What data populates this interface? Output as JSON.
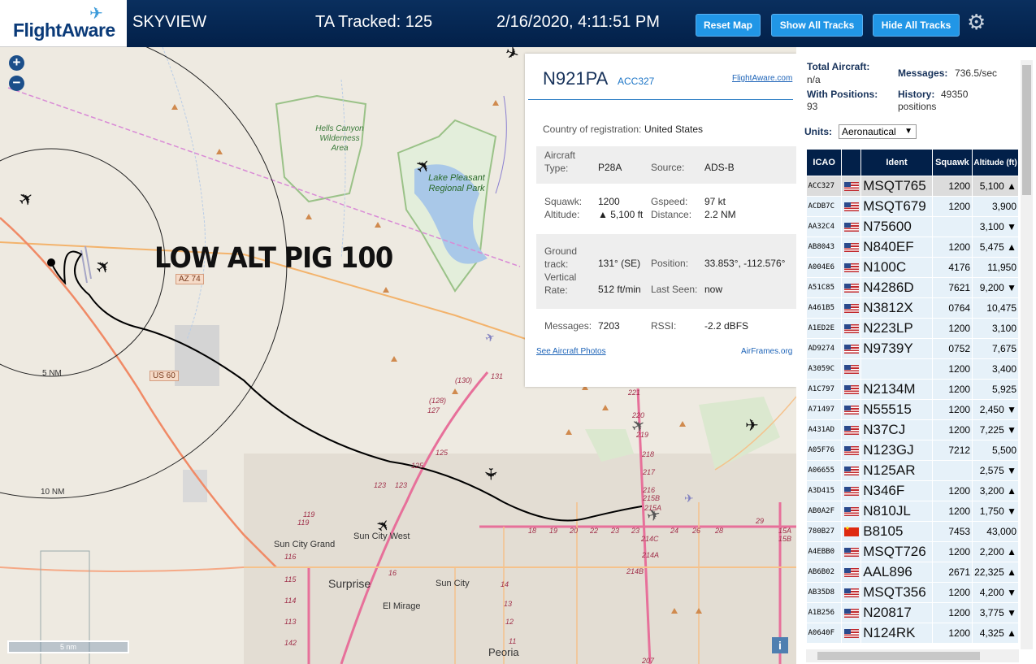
{
  "header": {
    "logo_text": "FlightAware",
    "app_name": "SKYVIEW",
    "tracked": "TA Tracked: 125",
    "datetime": "2/16/2020, 4:11:51 PM",
    "buttons": {
      "reset_map": "Reset Map",
      "show_all_tracks": "Show All Tracks",
      "hide_all_tracks": "Hide All Tracks"
    },
    "settings_icon": "gear-icon"
  },
  "map": {
    "zoom_in": "+",
    "zoom_out": "−",
    "overlay_text": "LOW ALT PIG 100",
    "range_labels": {
      "r5": "5 NM",
      "r10": "10 NM"
    },
    "places": {
      "hells_canyon": "Hells Canyon Wilderness Area",
      "lake_pleasant": "Lake Pleasant Regional Park",
      "sun_city_grand": "Sun City Grand",
      "sun_city_west": "Sun City West",
      "surprise": "Surprise",
      "sun_city": "Sun City",
      "el_mirage": "El Mirage",
      "peoria": "Peoria"
    },
    "shields": {
      "az74": "AZ 74",
      "us60": "US 60"
    },
    "scale": "5 nm",
    "info_button": "i",
    "exit_numbers": [
      "131",
      "(130)",
      "(128)",
      "127",
      "125",
      "125",
      "123",
      "123",
      "119",
      "119",
      "116",
      "115",
      "114",
      "113",
      "142",
      "16",
      "18",
      "19",
      "20",
      "22",
      "23",
      "23",
      "24",
      "26",
      "28",
      "29",
      "221",
      "220",
      "219",
      "218",
      "217",
      "216",
      "215B",
      "215A",
      "214C",
      "214A",
      "214B",
      "207",
      "15A",
      "15B",
      "14",
      "13",
      "12",
      "11"
    ]
  },
  "popup": {
    "registration": "N921PA",
    "callsign": "ACC327",
    "fa_link": "FlightAware.com",
    "country_label": "Country of registration:",
    "country_value": "United States",
    "aircraft_type_label": "Aircraft\nType:",
    "aircraft_type_value": "P28A",
    "source_label": "Source:",
    "source_value": "ADS-B",
    "squawk_label": "Squawk:",
    "squawk_value": "1200",
    "altitude_label": "Altitude:",
    "altitude_value": "▲ 5,100 ft",
    "gspeed_label": "Gspeed:",
    "gspeed_value": "97 kt",
    "distance_label": "Distance:",
    "distance_value": "2.2 NM",
    "ground_track_label": "Ground\ntrack:",
    "ground_track_value": "131° (SE)",
    "position_label": "Position:",
    "position_value": "33.853°, -112.576°",
    "vertical_rate_label": "Vertical\nRate:",
    "vertical_rate_value": "512 ft/min",
    "last_seen_label": "Last Seen:",
    "last_seen_value": "now",
    "messages_label": "Messages:",
    "messages_value": "7203",
    "rssi_label": "RSSI:",
    "rssi_value": "-2.2 dBFS",
    "photos_link": "See Aircraft Photos",
    "airframes_link": "AirFrames.org"
  },
  "panel": {
    "total_aircraft_label": "Total Aircraft:",
    "total_aircraft_value": "n/a",
    "with_positions_label": "With Positions:",
    "with_positions_value": "93",
    "messages_label": "Messages:",
    "messages_value": "736.5/sec",
    "history_label": "History:",
    "history_value": "49350 positions",
    "units_label": "Units:",
    "units_value": "Aeronautical",
    "columns": [
      "ICAO",
      "",
      "Ident",
      "Squawk",
      "Altitude (ft)"
    ],
    "rows": [
      {
        "icao": "ACC327",
        "flag": "us",
        "ident": "MSQT765",
        "squawk": "1200",
        "alt": "5,100 ▲",
        "selected": true
      },
      {
        "icao": "ACDB7C",
        "flag": "us",
        "ident": "MSQT679",
        "squawk": "1200",
        "alt": "3,900"
      },
      {
        "icao": "AA32C4",
        "flag": "us",
        "ident": "N75600",
        "squawk": "",
        "alt": "3,100 ▼"
      },
      {
        "icao": "AB8043",
        "flag": "us",
        "ident": "N840EF",
        "squawk": "1200",
        "alt": "5,475 ▲"
      },
      {
        "icao": "A004E6",
        "flag": "us",
        "ident": "N100C",
        "squawk": "4176",
        "alt": "11,950"
      },
      {
        "icao": "A51C85",
        "flag": "us",
        "ident": "N4286D",
        "squawk": "7621",
        "alt": "9,200 ▼"
      },
      {
        "icao": "A461B5",
        "flag": "us",
        "ident": "N3812X",
        "squawk": "0764",
        "alt": "10,475"
      },
      {
        "icao": "A1ED2E",
        "flag": "us",
        "ident": "N223LP",
        "squawk": "1200",
        "alt": "3,100"
      },
      {
        "icao": "AD9274",
        "flag": "us",
        "ident": "N9739Y",
        "squawk": "0752",
        "alt": "7,675"
      },
      {
        "icao": "A3059C",
        "flag": "us",
        "ident": "",
        "squawk": "1200",
        "alt": "3,400"
      },
      {
        "icao": "A1C797",
        "flag": "us",
        "ident": "N2134M",
        "squawk": "1200",
        "alt": "5,925"
      },
      {
        "icao": "A71497",
        "flag": "us",
        "ident": "N55515",
        "squawk": "1200",
        "alt": "2,450 ▼"
      },
      {
        "icao": "A431AD",
        "flag": "us",
        "ident": "N37CJ",
        "squawk": "1200",
        "alt": "7,225 ▼"
      },
      {
        "icao": "A05F76",
        "flag": "us",
        "ident": "N123GJ",
        "squawk": "7212",
        "alt": "5,500"
      },
      {
        "icao": "A06655",
        "flag": "us",
        "ident": "N125AR",
        "squawk": "",
        "alt": "2,575 ▼"
      },
      {
        "icao": "A3D415",
        "flag": "us",
        "ident": "N346F",
        "squawk": "1200",
        "alt": "3,200 ▲"
      },
      {
        "icao": "AB0A2F",
        "flag": "us",
        "ident": "N810JL",
        "squawk": "1200",
        "alt": "1,750 ▼"
      },
      {
        "icao": "780B27",
        "flag": "cn",
        "ident": "B8105",
        "squawk": "7453",
        "alt": "43,000"
      },
      {
        "icao": "A4EBB0",
        "flag": "us",
        "ident": "MSQT726",
        "squawk": "1200",
        "alt": "2,200 ▲"
      },
      {
        "icao": "AB6B02",
        "flag": "us",
        "ident": "AAL896",
        "squawk": "2671",
        "alt": "22,325 ▲"
      },
      {
        "icao": "AB35D8",
        "flag": "us",
        "ident": "MSQT356",
        "squawk": "1200",
        "alt": "4,200 ▼"
      },
      {
        "icao": "A1B256",
        "flag": "us",
        "ident": "N20817",
        "squawk": "1200",
        "alt": "3,775 ▼"
      },
      {
        "icao": "A0640F",
        "flag": "us",
        "ident": "N124RK",
        "squawk": "1200",
        "alt": "4,325 ▲"
      }
    ]
  }
}
